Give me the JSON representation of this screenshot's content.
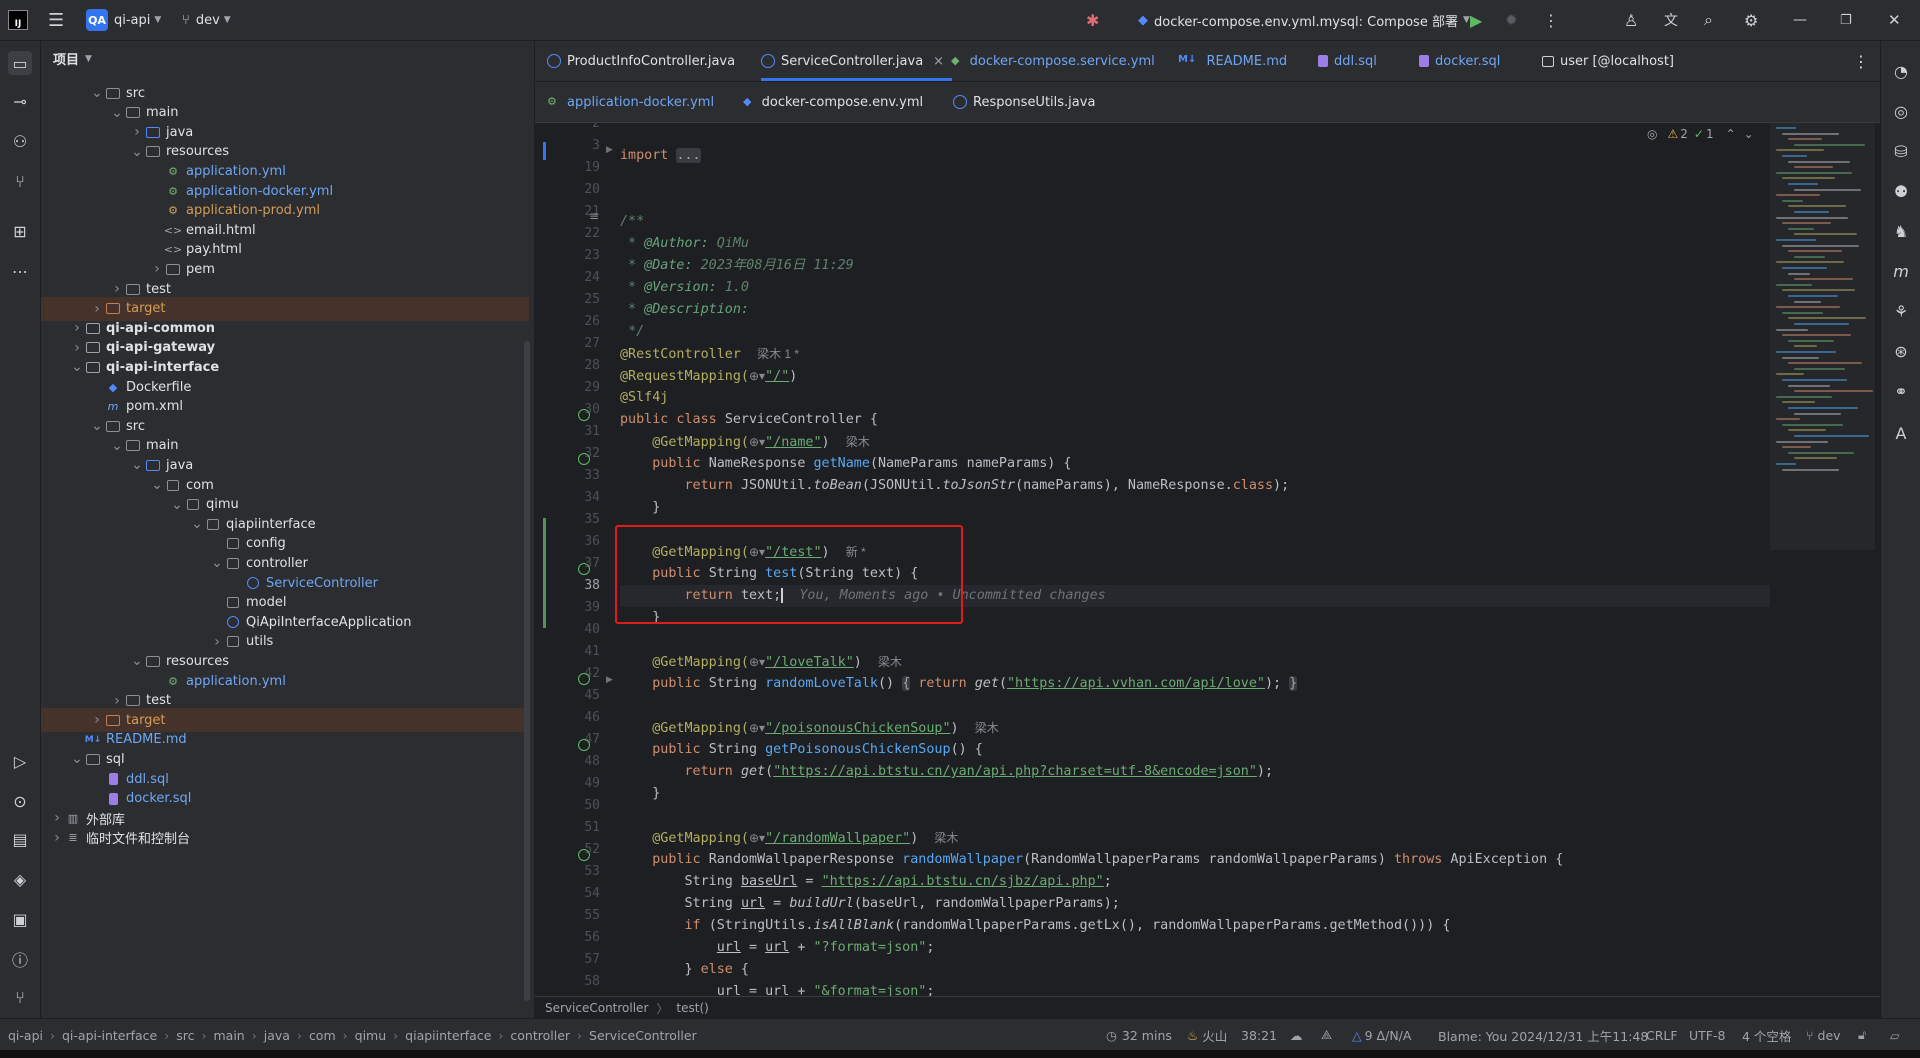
{
  "titlebar": {
    "project_badge": "QA",
    "project_name": "qi-api",
    "branch": "dev",
    "run_config": "docker-compose.env.yml.mysql: Compose 部署"
  },
  "project_panel": {
    "title": "项目",
    "tree": [
      {
        "label": "src",
        "depth": 2,
        "arrow": "down",
        "type": "folder"
      },
      {
        "label": "main",
        "depth": 3,
        "arrow": "down",
        "type": "folder"
      },
      {
        "label": "java",
        "depth": 4,
        "arrow": "right",
        "type": "folder-blue"
      },
      {
        "label": "resources",
        "depth": 4,
        "arrow": "down",
        "type": "folder"
      },
      {
        "label": "application.yml",
        "depth": 5,
        "arrow": "",
        "type": "yml"
      },
      {
        "label": "application-docker.yml",
        "depth": 5,
        "arrow": "",
        "type": "yml"
      },
      {
        "label": "application-prod.yml",
        "depth": 5,
        "arrow": "",
        "type": "yml-orange"
      },
      {
        "label": "email.html",
        "depth": 5,
        "arrow": "",
        "type": "html"
      },
      {
        "label": "pay.html",
        "depth": 5,
        "arrow": "",
        "type": "html"
      },
      {
        "label": "pem",
        "depth": 5,
        "arrow": "right",
        "type": "folder"
      },
      {
        "label": "test",
        "depth": 3,
        "arrow": "right",
        "type": "folder"
      },
      {
        "label": "target",
        "depth": 2,
        "arrow": "right",
        "type": "folder-orange",
        "hl": true
      },
      {
        "label": "qi-api-common",
        "depth": 1,
        "arrow": "right",
        "type": "module"
      },
      {
        "label": "qi-api-gateway",
        "depth": 1,
        "arrow": "right",
        "type": "module"
      },
      {
        "label": "qi-api-interface",
        "depth": 1,
        "arrow": "down",
        "type": "module"
      },
      {
        "label": "Dockerfile",
        "depth": 2,
        "arrow": "",
        "type": "docker"
      },
      {
        "label": "pom.xml",
        "depth": 2,
        "arrow": "",
        "type": "maven"
      },
      {
        "label": "src",
        "depth": 2,
        "arrow": "down",
        "type": "folder"
      },
      {
        "label": "main",
        "depth": 3,
        "arrow": "down",
        "type": "folder"
      },
      {
        "label": "java",
        "depth": 4,
        "arrow": "down",
        "type": "folder-blue"
      },
      {
        "label": "com",
        "depth": 5,
        "arrow": "down",
        "type": "package"
      },
      {
        "label": "qimu",
        "depth": 6,
        "arrow": "down",
        "type": "package"
      },
      {
        "label": "qiapiinterface",
        "depth": 7,
        "arrow": "down",
        "type": "package"
      },
      {
        "label": "config",
        "depth": 8,
        "arrow": "",
        "type": "package"
      },
      {
        "label": "controller",
        "depth": 8,
        "arrow": "down",
        "type": "package"
      },
      {
        "label": "ServiceController",
        "depth": 9,
        "arrow": "",
        "type": "class"
      },
      {
        "label": "model",
        "depth": 8,
        "arrow": "",
        "type": "package"
      },
      {
        "label": "QiApiInterfaceApplication",
        "depth": 8,
        "arrow": "",
        "type": "app"
      },
      {
        "label": "utils",
        "depth": 8,
        "arrow": "right",
        "type": "package"
      },
      {
        "label": "resources",
        "depth": 4,
        "arrow": "down",
        "type": "folder"
      },
      {
        "label": "application.yml",
        "depth": 5,
        "arrow": "",
        "type": "yml"
      },
      {
        "label": "test",
        "depth": 3,
        "arrow": "right",
        "type": "folder"
      },
      {
        "label": "target",
        "depth": 2,
        "arrow": "right",
        "type": "folder-orange",
        "hl": true
      },
      {
        "label": "README.md",
        "depth": 1,
        "arrow": "",
        "type": "md"
      },
      {
        "label": "sql",
        "depth": 1,
        "arrow": "down",
        "type": "folder"
      },
      {
        "label": "ddl.sql",
        "depth": 2,
        "arrow": "",
        "type": "sql"
      },
      {
        "label": "docker.sql",
        "depth": 2,
        "arrow": "",
        "type": "sql"
      },
      {
        "label": "外部库",
        "depth": 0,
        "arrow": "right",
        "type": "lib"
      },
      {
        "label": "临时文件和控制台",
        "depth": 0,
        "arrow": "right",
        "type": "scratch"
      }
    ]
  },
  "tabs_row1": [
    {
      "label": "ProductInfoController.java",
      "icon": "class",
      "blue": false
    },
    {
      "label": "ServiceController.java",
      "icon": "class",
      "active": true,
      "close": "×"
    },
    {
      "label": "docker-compose.service.yml",
      "icon": "compose",
      "blue": true
    },
    {
      "label": "README.md",
      "icon": "md",
      "blue": true
    },
    {
      "label": "ddl.sql",
      "icon": "sql",
      "blue": true
    },
    {
      "label": "docker.sql",
      "icon": "sql",
      "blue": true
    },
    {
      "label": "user [@localhost]",
      "icon": "table",
      "blue": false
    }
  ],
  "tabs_row2": [
    {
      "label": "application-docker.yml",
      "icon": "yml",
      "blue": true
    },
    {
      "label": "docker-compose.env.yml",
      "icon": "compose",
      "blue": false
    },
    {
      "label": "ResponseUtils.java",
      "icon": "class",
      "blue": false
    }
  ],
  "editor": {
    "inspections": {
      "warnings": "2",
      "ok": "1"
    },
    "current_line": "38",
    "line_numbers": [
      "2",
      "3",
      "19",
      "20",
      "21",
      "22",
      "23",
      "24",
      "25",
      "26",
      "27",
      "28",
      "29",
      "30",
      "31",
      "32",
      "33",
      "34",
      "35",
      "36",
      "37",
      "38",
      "39",
      "40",
      "41",
      "42",
      "45",
      "46",
      "47",
      "48",
      "49",
      "50",
      "51",
      "52",
      "53",
      "54",
      "55",
      "56",
      "57",
      "58"
    ]
  },
  "code": {
    "import_kw": "import",
    "import_fold": "...",
    "doc_open": "/**",
    "author_tag": "@Author:",
    "author": "QiMu",
    "date_tag": "@Date:",
    "date": "2023年08月16日 11:29",
    "version_tag": "@Version:",
    "version": "1.0",
    "desc_tag": "@Description:",
    "doc_close": "*/",
    "restcontroller": "@RestController",
    "restcontroller_author": "梁木 1 *",
    "requestmapping": "@RequestMapping(",
    "requestmapping_val": "\"/\"",
    "slf4j": "@Slf4j",
    "class_decl_kw": "public class ",
    "class_name": "ServiceController {",
    "getmapping": "@GetMapping(",
    "m1_path": "\"/name\"",
    "m1_author": "梁木",
    "m1_sig": "NameResponse ",
    "m1_name": "getName",
    "m1_params": "(NameParams nameParams) {",
    "m1_ret_kw": "return ",
    "m1_ret_a": "JSONUtil.",
    "m1_ret_b": "toBean",
    "m1_ret_c": "(JSONUtil.",
    "m1_ret_d": "toJsonStr",
    "m1_ret_e": "(nameParams), NameResponse.",
    "m1_ret_f": "class",
    "m1_ret_g": ");",
    "close_brace": "}",
    "m2_path": "\"/test\"",
    "m2_author": "新 *",
    "m2_sig": "String ",
    "m2_name": "test",
    "m2_params": "(String text) {",
    "m2_ret": "text;",
    "m2_blame": "You, Moments ago • Uncommitted changes",
    "m3_path": "\"/loveTalk\"",
    "m3_author": "梁木",
    "m3_name": "randomLoveTalk",
    "m3_body_kw": "return ",
    "m3_call": "get",
    "m3_url": "\"https://api.vvhan.com/api/love\"",
    "m4_path": "\"/poisonousChickenSoup\"",
    "m4_author": "梁木",
    "m4_name": "getPoisonousChickenSoup",
    "m4_url": "\"https://api.btstu.cn/yan/api.php?charset=utf-8&encode=json\"",
    "m5_path": "\"/randomWallpaper\"",
    "m5_author": "梁木",
    "m5_sig": "RandomWallpaperResponse ",
    "m5_name": "randomWallpaper",
    "m5_params": "(RandomWallpaperParams randomWallpaperParams) ",
    "m5_throws": "throws",
    "m5_exc": " ApiException {",
    "l53_a": "String ",
    "l53_var": "baseUrl",
    "l53_b": " = ",
    "l53_url": "\"https://api.btstu.cn/sjbz/api.php\"",
    "l54_a": "String ",
    "l54_var": "url",
    "l54_b": " = ",
    "l54_call": "buildUrl",
    "l54_c": "(baseUrl, randomWallpaperParams);",
    "l55_kw": "if ",
    "l55_a": "(StringUtils.",
    "l55_call": "isAllBlank",
    "l55_b": "(randomWallpaperParams.getLx(), randomWallpaperParams.getMethod())) {",
    "l56_var": "url",
    "l56_b": " = ",
    "l56_var2": "url",
    "l56_c": " + ",
    "l56_str": "\"?format=json\"",
    "l57_a": "} ",
    "l57_kw": "else",
    "l57_b": " {",
    "l58_str": "\"&format=json\""
  },
  "editor_breadcrumb": [
    "ServiceController",
    "test()"
  ],
  "statusbar": {
    "path": [
      "qi-api",
      "qi-api-interface",
      "src",
      "main",
      "java",
      "com",
      "qimu",
      "qiapiinterface",
      "controller",
      "ServiceController"
    ],
    "time": "32 mins",
    "engine": "火山",
    "position": "38:21",
    "changes": "9 Δ/N/A",
    "blame": "Blame: You 2024/12/31 上午11:48",
    "line_sep": "CRLF",
    "encoding": "UTF-8",
    "indent": "4 个空格",
    "branch": "dev"
  }
}
